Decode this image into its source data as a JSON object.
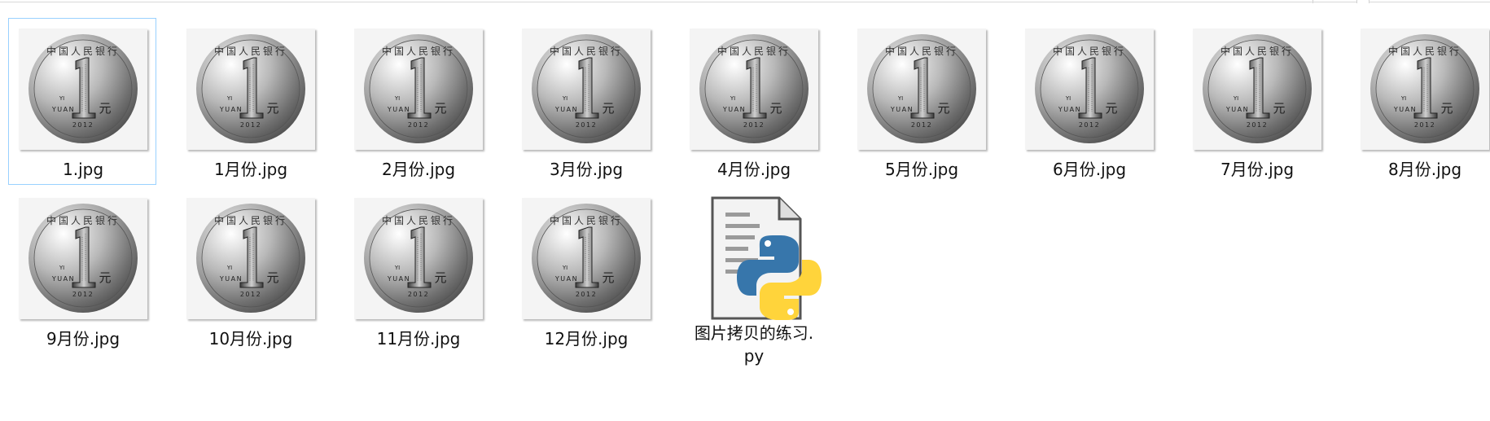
{
  "files": [
    {
      "name": "1.jpg",
      "selected": true
    },
    {
      "name": "1月份.jpg"
    },
    {
      "name": "2月份.jpg"
    },
    {
      "name": "3月份.jpg"
    },
    {
      "name": "4月份.jpg"
    },
    {
      "name": "5月份.jpg"
    },
    {
      "name": "6月份.jpg"
    },
    {
      "name": "7月份.jpg"
    },
    {
      "name": "8月份.jpg"
    },
    {
      "name": "9月份.jpg"
    },
    {
      "name": "10月份.jpg"
    },
    {
      "name": "11月份.jpg"
    },
    {
      "name": "12月份.jpg"
    }
  ],
  "python_file": {
    "name_line1": "图片拷贝的练习.",
    "name_line2": "py",
    "icon": "python-file-icon"
  },
  "coin": {
    "top_text": "中国人民银行",
    "denomination": "1",
    "yi": "YI",
    "yuan": "YUAN",
    "yuan_cn": "元",
    "year": "2012"
  },
  "colors": {
    "selection_border": "#99d1ff",
    "python_blue": "#3776ab",
    "python_yellow": "#ffd43b"
  }
}
